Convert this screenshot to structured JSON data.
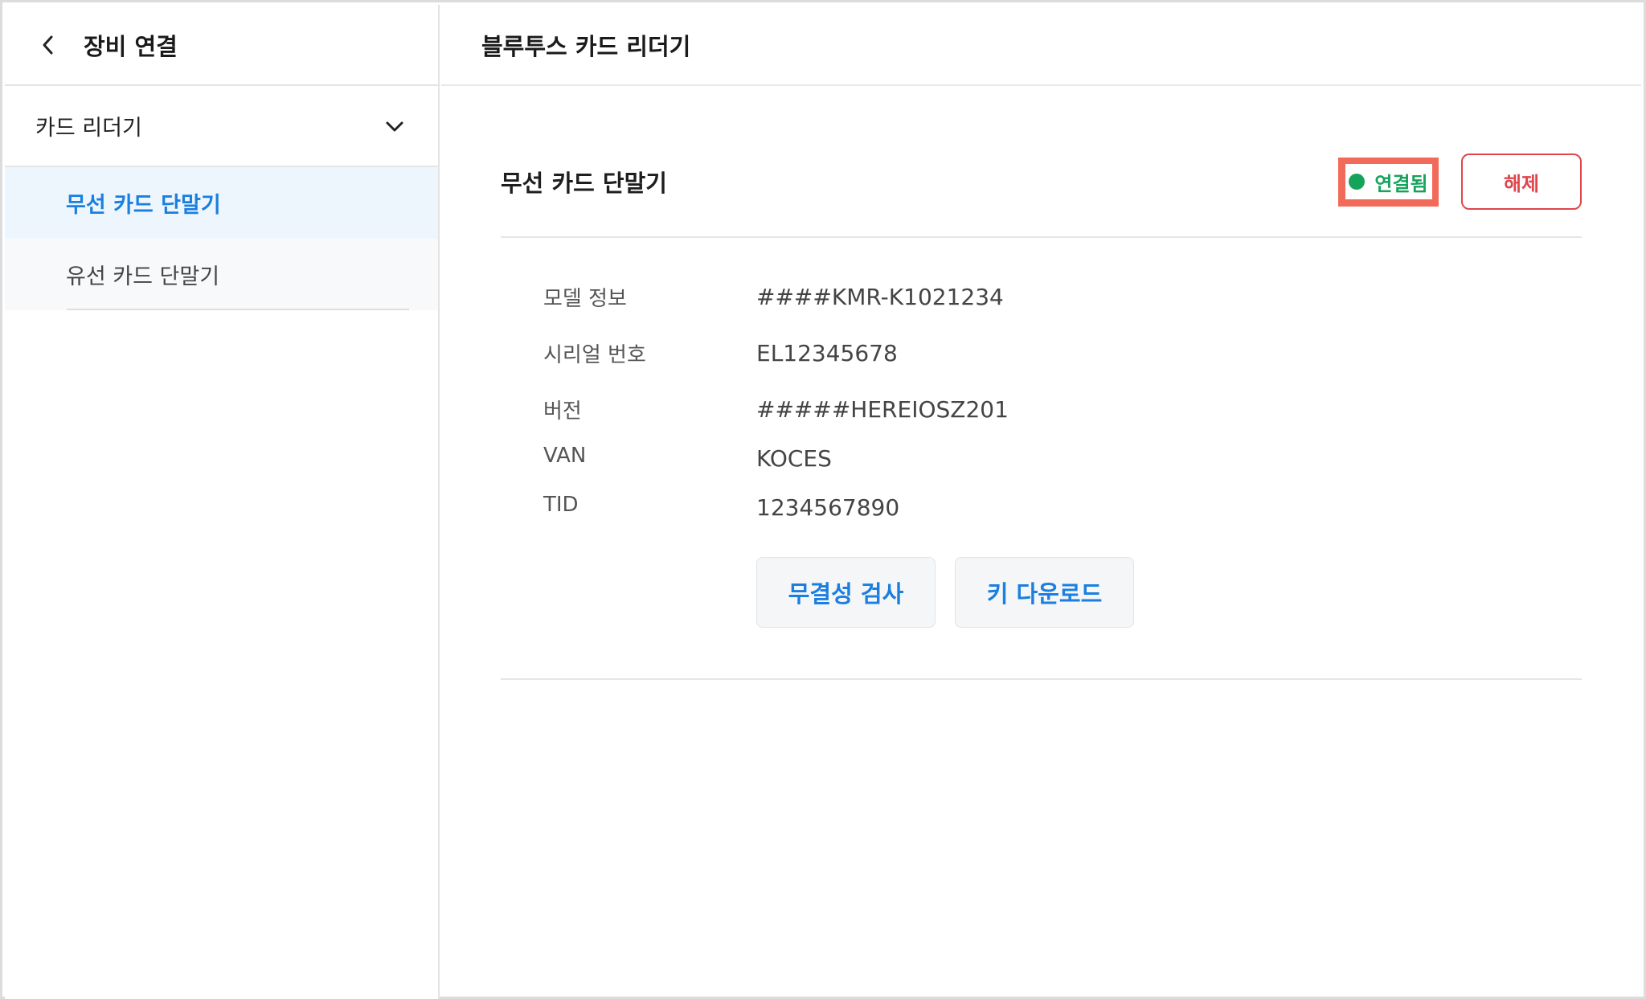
{
  "sidebar": {
    "title": "장비 연결",
    "group": {
      "label": "카드 리더기"
    },
    "items": [
      {
        "label": "무선 카드 단말기",
        "active": true
      },
      {
        "label": "유선 카드 단말기",
        "active": false
      }
    ]
  },
  "main": {
    "title": "블루투스 카드 리더기",
    "device": {
      "name": "무선 카드 단말기",
      "status": "연결됨",
      "disconnect_label": "해제"
    },
    "info": [
      {
        "label": "모델 정보",
        "value": "####KMR-K1021234"
      },
      {
        "label": "시리얼 번호",
        "value": "EL12345678"
      },
      {
        "label": "버전",
        "value": "#####HEREIOSZ201"
      },
      {
        "label": "VAN",
        "value": "KOCES"
      },
      {
        "label": "TID",
        "value": "1234567890"
      }
    ],
    "buttons": {
      "integrity_check": "무결성 검사",
      "key_download": "키 다운로드"
    }
  },
  "colors": {
    "accent_blue": "#1a7fe0",
    "status_green": "#15a35c",
    "danger_red": "#e0454c",
    "highlight_red": "#f26a59",
    "active_item_bg": "#eef6fd"
  },
  "icons": {
    "back": "chevron-left-icon",
    "expand": "chevron-down-icon",
    "status": "status-dot-icon"
  }
}
